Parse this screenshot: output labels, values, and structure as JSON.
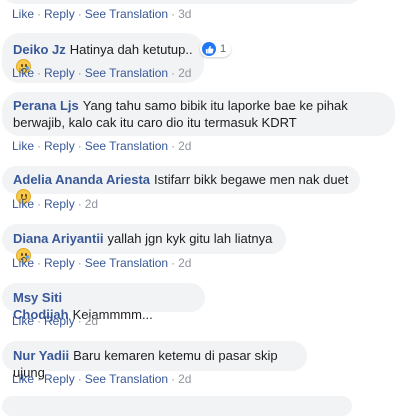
{
  "labels": {
    "like": "Like",
    "reply": "Reply",
    "see_translation": "See Translation",
    "separator": "·"
  },
  "top_comment": {
    "time": "3d"
  },
  "comments": [
    {
      "author": "Deiko Jz",
      "text": "Hatinya dah ketutup..",
      "emoji": "sad-face-icon",
      "reaction_count": "1",
      "time": "2d"
    },
    {
      "author": "Perana Ljs",
      "text": "Yang tahu samo bibik itu laporke bae ke pihak berwajib, kalo cak itu caro dio itu termasuk KDRT",
      "time": "2d"
    },
    {
      "author": "Adelia Ananda Ariesta",
      "text": "Istifarr bikk begawe men nak duet",
      "emoji": "smile-face-icon",
      "time": "2d"
    },
    {
      "author": "Diana Ariyantii",
      "text": "yallah jgn kyk gitu lah liatnya",
      "emoji": "sad-face-icon",
      "time": "2d"
    },
    {
      "author": "Msy Siti Chodijah",
      "text": "Kejammmm...",
      "time": "2d"
    },
    {
      "author": "Nur Yadii",
      "text": "Baru kemaren ketemu di pasar skip ujung",
      "time": "2d"
    }
  ],
  "colors": {
    "link": "#385898",
    "bubble": "#f2f3f5",
    "meta": "#90949c",
    "like_blue": "#2078f4"
  }
}
